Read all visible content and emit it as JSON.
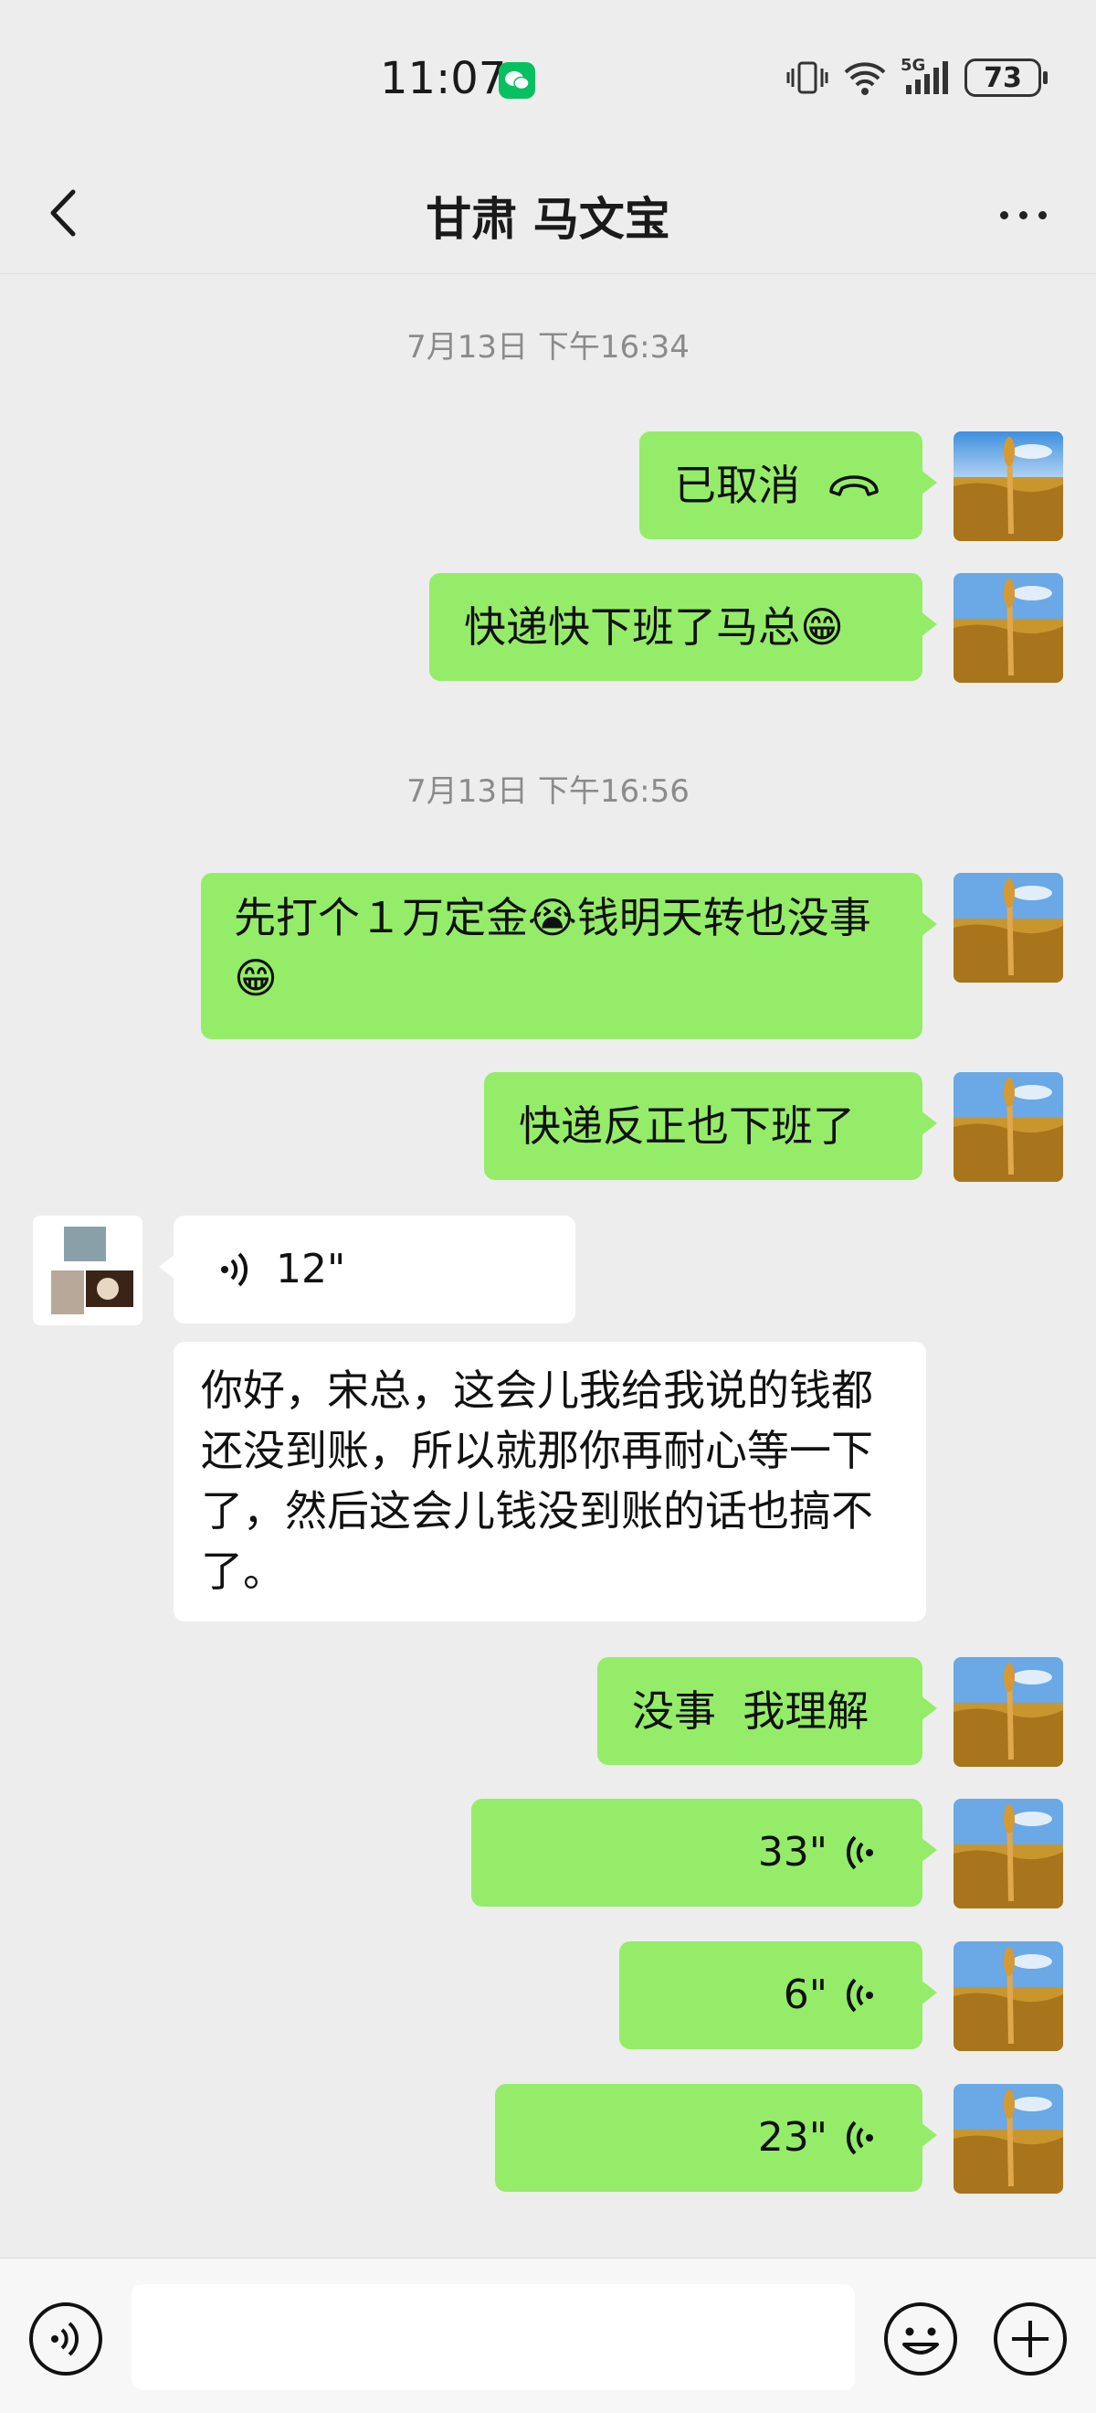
{
  "status_bar": {
    "time": "11:07",
    "network": "5G",
    "battery": "73"
  },
  "nav": {
    "title": "甘肃 马文宝"
  },
  "timestamps": [
    "7月13日 下午16:34",
    "7月13日 下午16:56"
  ],
  "messages": [
    {
      "from": "me",
      "type": "call",
      "text": "已取消"
    },
    {
      "from": "me",
      "type": "text",
      "text": "快递快下班了马总😁"
    },
    {
      "from": "me",
      "type": "text",
      "text": "先打个１万定金😭钱明天转也没事 😁"
    },
    {
      "from": "me",
      "type": "text",
      "text": "快递反正也下班了"
    },
    {
      "from": "them",
      "type": "voice",
      "duration": "12\""
    },
    {
      "from": "them",
      "type": "text",
      "text": "你好，宋总，这会儿我给我说的钱都还没到账，所以就那你再耐心等一下了，然后这会儿钱没到账的话也搞不了。"
    },
    {
      "from": "me",
      "type": "text",
      "text": "没事  我理解"
    },
    {
      "from": "me",
      "type": "voice",
      "duration": "33\""
    },
    {
      "from": "me",
      "type": "voice",
      "duration": "6\""
    },
    {
      "from": "me",
      "type": "voice",
      "duration": "23\""
    }
  ],
  "input": {
    "value": ""
  },
  "colors": {
    "my_bubble": "#95ec69",
    "their_bubble": "#ffffff",
    "background": "#ededed",
    "wechat": "#07c160"
  }
}
